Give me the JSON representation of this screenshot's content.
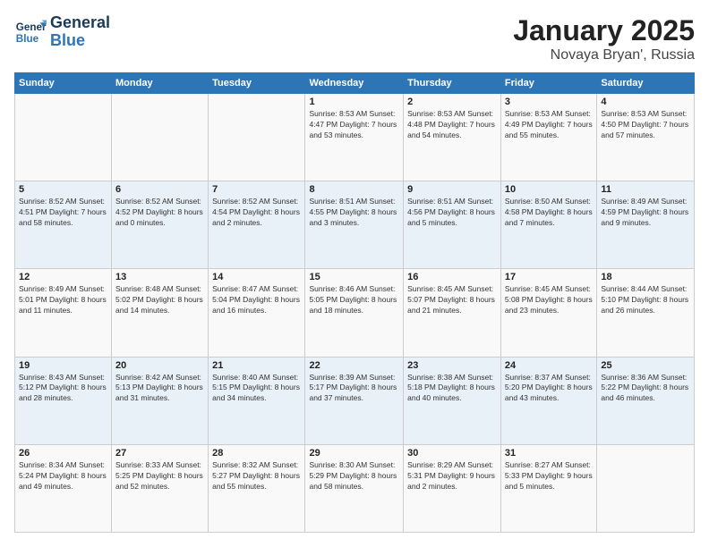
{
  "logo": {
    "line1": "General",
    "line2": "Blue"
  },
  "title": "January 2025",
  "subtitle": "Novaya Bryan', Russia",
  "headers": [
    "Sunday",
    "Monday",
    "Tuesday",
    "Wednesday",
    "Thursday",
    "Friday",
    "Saturday"
  ],
  "weeks": [
    [
      {
        "day": "",
        "info": ""
      },
      {
        "day": "",
        "info": ""
      },
      {
        "day": "",
        "info": ""
      },
      {
        "day": "1",
        "info": "Sunrise: 8:53 AM\nSunset: 4:47 PM\nDaylight: 7 hours\nand 53 minutes."
      },
      {
        "day": "2",
        "info": "Sunrise: 8:53 AM\nSunset: 4:48 PM\nDaylight: 7 hours\nand 54 minutes."
      },
      {
        "day": "3",
        "info": "Sunrise: 8:53 AM\nSunset: 4:49 PM\nDaylight: 7 hours\nand 55 minutes."
      },
      {
        "day": "4",
        "info": "Sunrise: 8:53 AM\nSunset: 4:50 PM\nDaylight: 7 hours\nand 57 minutes."
      }
    ],
    [
      {
        "day": "5",
        "info": "Sunrise: 8:52 AM\nSunset: 4:51 PM\nDaylight: 7 hours\nand 58 minutes."
      },
      {
        "day": "6",
        "info": "Sunrise: 8:52 AM\nSunset: 4:52 PM\nDaylight: 8 hours\nand 0 minutes."
      },
      {
        "day": "7",
        "info": "Sunrise: 8:52 AM\nSunset: 4:54 PM\nDaylight: 8 hours\nand 2 minutes."
      },
      {
        "day": "8",
        "info": "Sunrise: 8:51 AM\nSunset: 4:55 PM\nDaylight: 8 hours\nand 3 minutes."
      },
      {
        "day": "9",
        "info": "Sunrise: 8:51 AM\nSunset: 4:56 PM\nDaylight: 8 hours\nand 5 minutes."
      },
      {
        "day": "10",
        "info": "Sunrise: 8:50 AM\nSunset: 4:58 PM\nDaylight: 8 hours\nand 7 minutes."
      },
      {
        "day": "11",
        "info": "Sunrise: 8:49 AM\nSunset: 4:59 PM\nDaylight: 8 hours\nand 9 minutes."
      }
    ],
    [
      {
        "day": "12",
        "info": "Sunrise: 8:49 AM\nSunset: 5:01 PM\nDaylight: 8 hours\nand 11 minutes."
      },
      {
        "day": "13",
        "info": "Sunrise: 8:48 AM\nSunset: 5:02 PM\nDaylight: 8 hours\nand 14 minutes."
      },
      {
        "day": "14",
        "info": "Sunrise: 8:47 AM\nSunset: 5:04 PM\nDaylight: 8 hours\nand 16 minutes."
      },
      {
        "day": "15",
        "info": "Sunrise: 8:46 AM\nSunset: 5:05 PM\nDaylight: 8 hours\nand 18 minutes."
      },
      {
        "day": "16",
        "info": "Sunrise: 8:45 AM\nSunset: 5:07 PM\nDaylight: 8 hours\nand 21 minutes."
      },
      {
        "day": "17",
        "info": "Sunrise: 8:45 AM\nSunset: 5:08 PM\nDaylight: 8 hours\nand 23 minutes."
      },
      {
        "day": "18",
        "info": "Sunrise: 8:44 AM\nSunset: 5:10 PM\nDaylight: 8 hours\nand 26 minutes."
      }
    ],
    [
      {
        "day": "19",
        "info": "Sunrise: 8:43 AM\nSunset: 5:12 PM\nDaylight: 8 hours\nand 28 minutes."
      },
      {
        "day": "20",
        "info": "Sunrise: 8:42 AM\nSunset: 5:13 PM\nDaylight: 8 hours\nand 31 minutes."
      },
      {
        "day": "21",
        "info": "Sunrise: 8:40 AM\nSunset: 5:15 PM\nDaylight: 8 hours\nand 34 minutes."
      },
      {
        "day": "22",
        "info": "Sunrise: 8:39 AM\nSunset: 5:17 PM\nDaylight: 8 hours\nand 37 minutes."
      },
      {
        "day": "23",
        "info": "Sunrise: 8:38 AM\nSunset: 5:18 PM\nDaylight: 8 hours\nand 40 minutes."
      },
      {
        "day": "24",
        "info": "Sunrise: 8:37 AM\nSunset: 5:20 PM\nDaylight: 8 hours\nand 43 minutes."
      },
      {
        "day": "25",
        "info": "Sunrise: 8:36 AM\nSunset: 5:22 PM\nDaylight: 8 hours\nand 46 minutes."
      }
    ],
    [
      {
        "day": "26",
        "info": "Sunrise: 8:34 AM\nSunset: 5:24 PM\nDaylight: 8 hours\nand 49 minutes."
      },
      {
        "day": "27",
        "info": "Sunrise: 8:33 AM\nSunset: 5:25 PM\nDaylight: 8 hours\nand 52 minutes."
      },
      {
        "day": "28",
        "info": "Sunrise: 8:32 AM\nSunset: 5:27 PM\nDaylight: 8 hours\nand 55 minutes."
      },
      {
        "day": "29",
        "info": "Sunrise: 8:30 AM\nSunset: 5:29 PM\nDaylight: 8 hours\nand 58 minutes."
      },
      {
        "day": "30",
        "info": "Sunrise: 8:29 AM\nSunset: 5:31 PM\nDaylight: 9 hours\nand 2 minutes."
      },
      {
        "day": "31",
        "info": "Sunrise: 8:27 AM\nSunset: 5:33 PM\nDaylight: 9 hours\nand 5 minutes."
      },
      {
        "day": "",
        "info": ""
      }
    ]
  ]
}
